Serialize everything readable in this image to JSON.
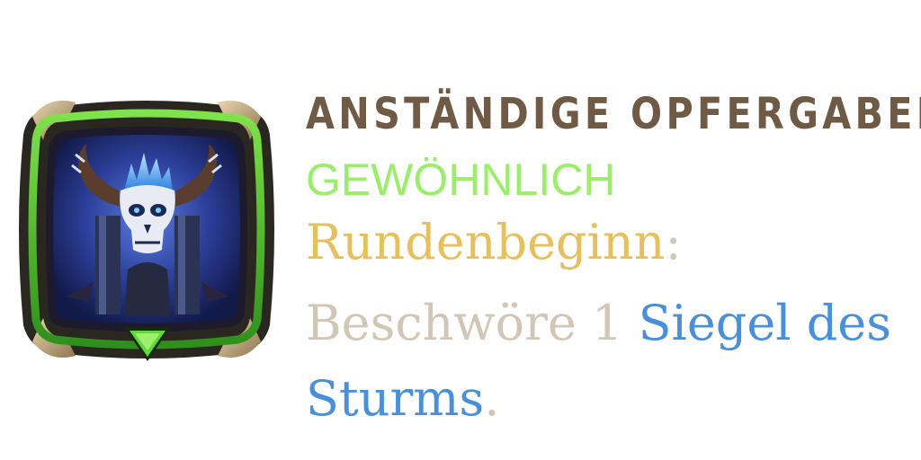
{
  "card": {
    "title": "ANSTÄNDIGE OPFERGABEN",
    "rarity": "GEWÖHNLICH",
    "trigger": "Rundenbeginn",
    "trigger_colon": ":",
    "effect_prefix": "Beschwöre 1 ",
    "effect_keyword_part1": "Siegel des",
    "effect_keyword_part2": "Sturms",
    "effect_period": "."
  },
  "icon": {
    "name": "horned-skull-totem-icon",
    "badge": "green-down-arrow-icon"
  },
  "colors": {
    "title": "#6e5a45",
    "rarity": "#9bee6c",
    "trigger": "#e6c05e",
    "plain_text": "#d2c6b6",
    "keyword": "#4a90d8",
    "frame_green": "#4bbf2a",
    "frame_dark": "#2a2620",
    "frame_gold": "#c8b185",
    "background_blue": "#2c3f9a"
  }
}
